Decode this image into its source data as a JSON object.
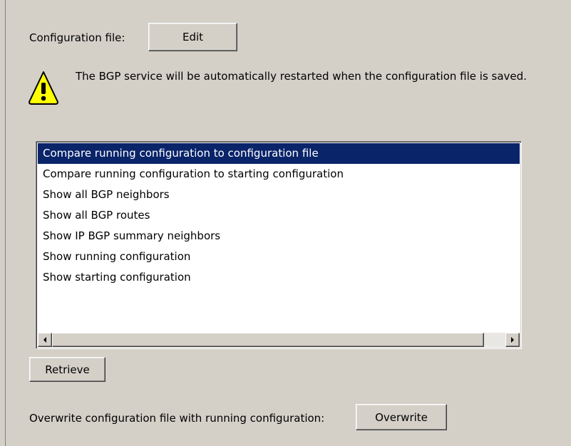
{
  "config": {
    "label": "Configuration file:",
    "edit_button": "Edit"
  },
  "warning": {
    "icon": "warning-icon",
    "text": "The BGP service will be automatically restarted when the configuration file is saved."
  },
  "commands": {
    "items": [
      {
        "label": "Compare running configuration to configuration file",
        "selected": true
      },
      {
        "label": "Compare running configuration to starting configuration",
        "selected": false
      },
      {
        "label": "Show all BGP neighbors",
        "selected": false
      },
      {
        "label": "Show all BGP routes",
        "selected": false
      },
      {
        "label": "Show IP BGP summary neighbors",
        "selected": false
      },
      {
        "label": "Show running configuration",
        "selected": false
      },
      {
        "label": "Show starting configuration",
        "selected": false
      }
    ],
    "selection_color": "#0a246a"
  },
  "retrieve_button": "Retrieve",
  "overwrite": {
    "label": "Overwrite configuration file with running configuration:",
    "button": "Overwrite"
  }
}
